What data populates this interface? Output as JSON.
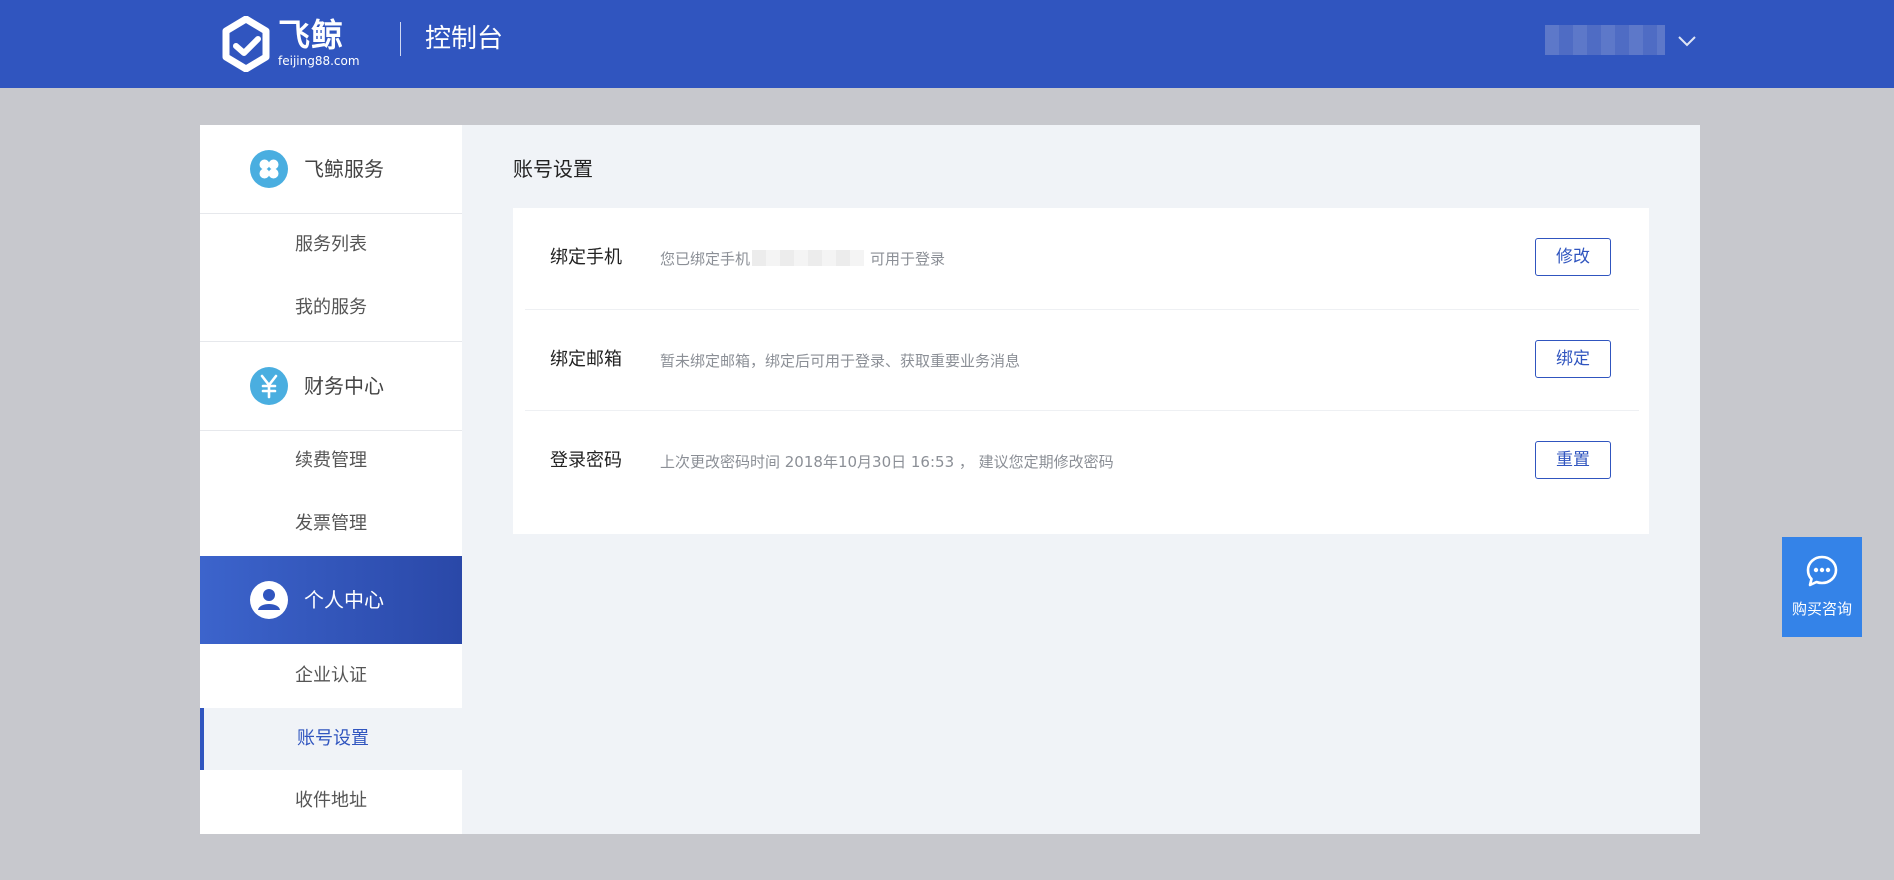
{
  "header": {
    "brand_name": "飞鲸",
    "brand_domain": "feijing88.com",
    "console_title": "控制台",
    "user_name": "",
    "user_menu_icon": "chevron-down-icon",
    "brand_color": "#3055bf"
  },
  "sidebar": {
    "groups": [
      {
        "label": "飞鲸服务",
        "icon": "clover-icon",
        "items": [
          {
            "label": "服务列表"
          },
          {
            "label": "我的服务"
          }
        ]
      },
      {
        "label": "财务中心",
        "icon": "yen-icon",
        "items": [
          {
            "label": "续费管理"
          },
          {
            "label": "发票管理"
          }
        ]
      },
      {
        "label": "个人中心",
        "icon": "user-icon",
        "active": true,
        "items": [
          {
            "label": "企业认证"
          },
          {
            "label": "账号设置",
            "active": true
          },
          {
            "label": "收件地址"
          }
        ]
      }
    ]
  },
  "main": {
    "title": "账号设置",
    "rows": [
      {
        "label": "绑定手机",
        "desc_prefix": "您已绑定手机",
        "desc_suffix": "可用于登录",
        "button": "修改"
      },
      {
        "label": "绑定邮箱",
        "desc": "暂未绑定邮箱，绑定后可用于登录、获取重要业务消息",
        "button": "绑定"
      },
      {
        "label": "登录密码",
        "desc": "上次更改密码时间 2018年10月30日 16:53 ， 建议您定期修改密码",
        "button": "重置"
      }
    ]
  },
  "consult": {
    "label": "购买咨询",
    "icon": "chat-bubble-icon",
    "color": "#3483e8"
  }
}
